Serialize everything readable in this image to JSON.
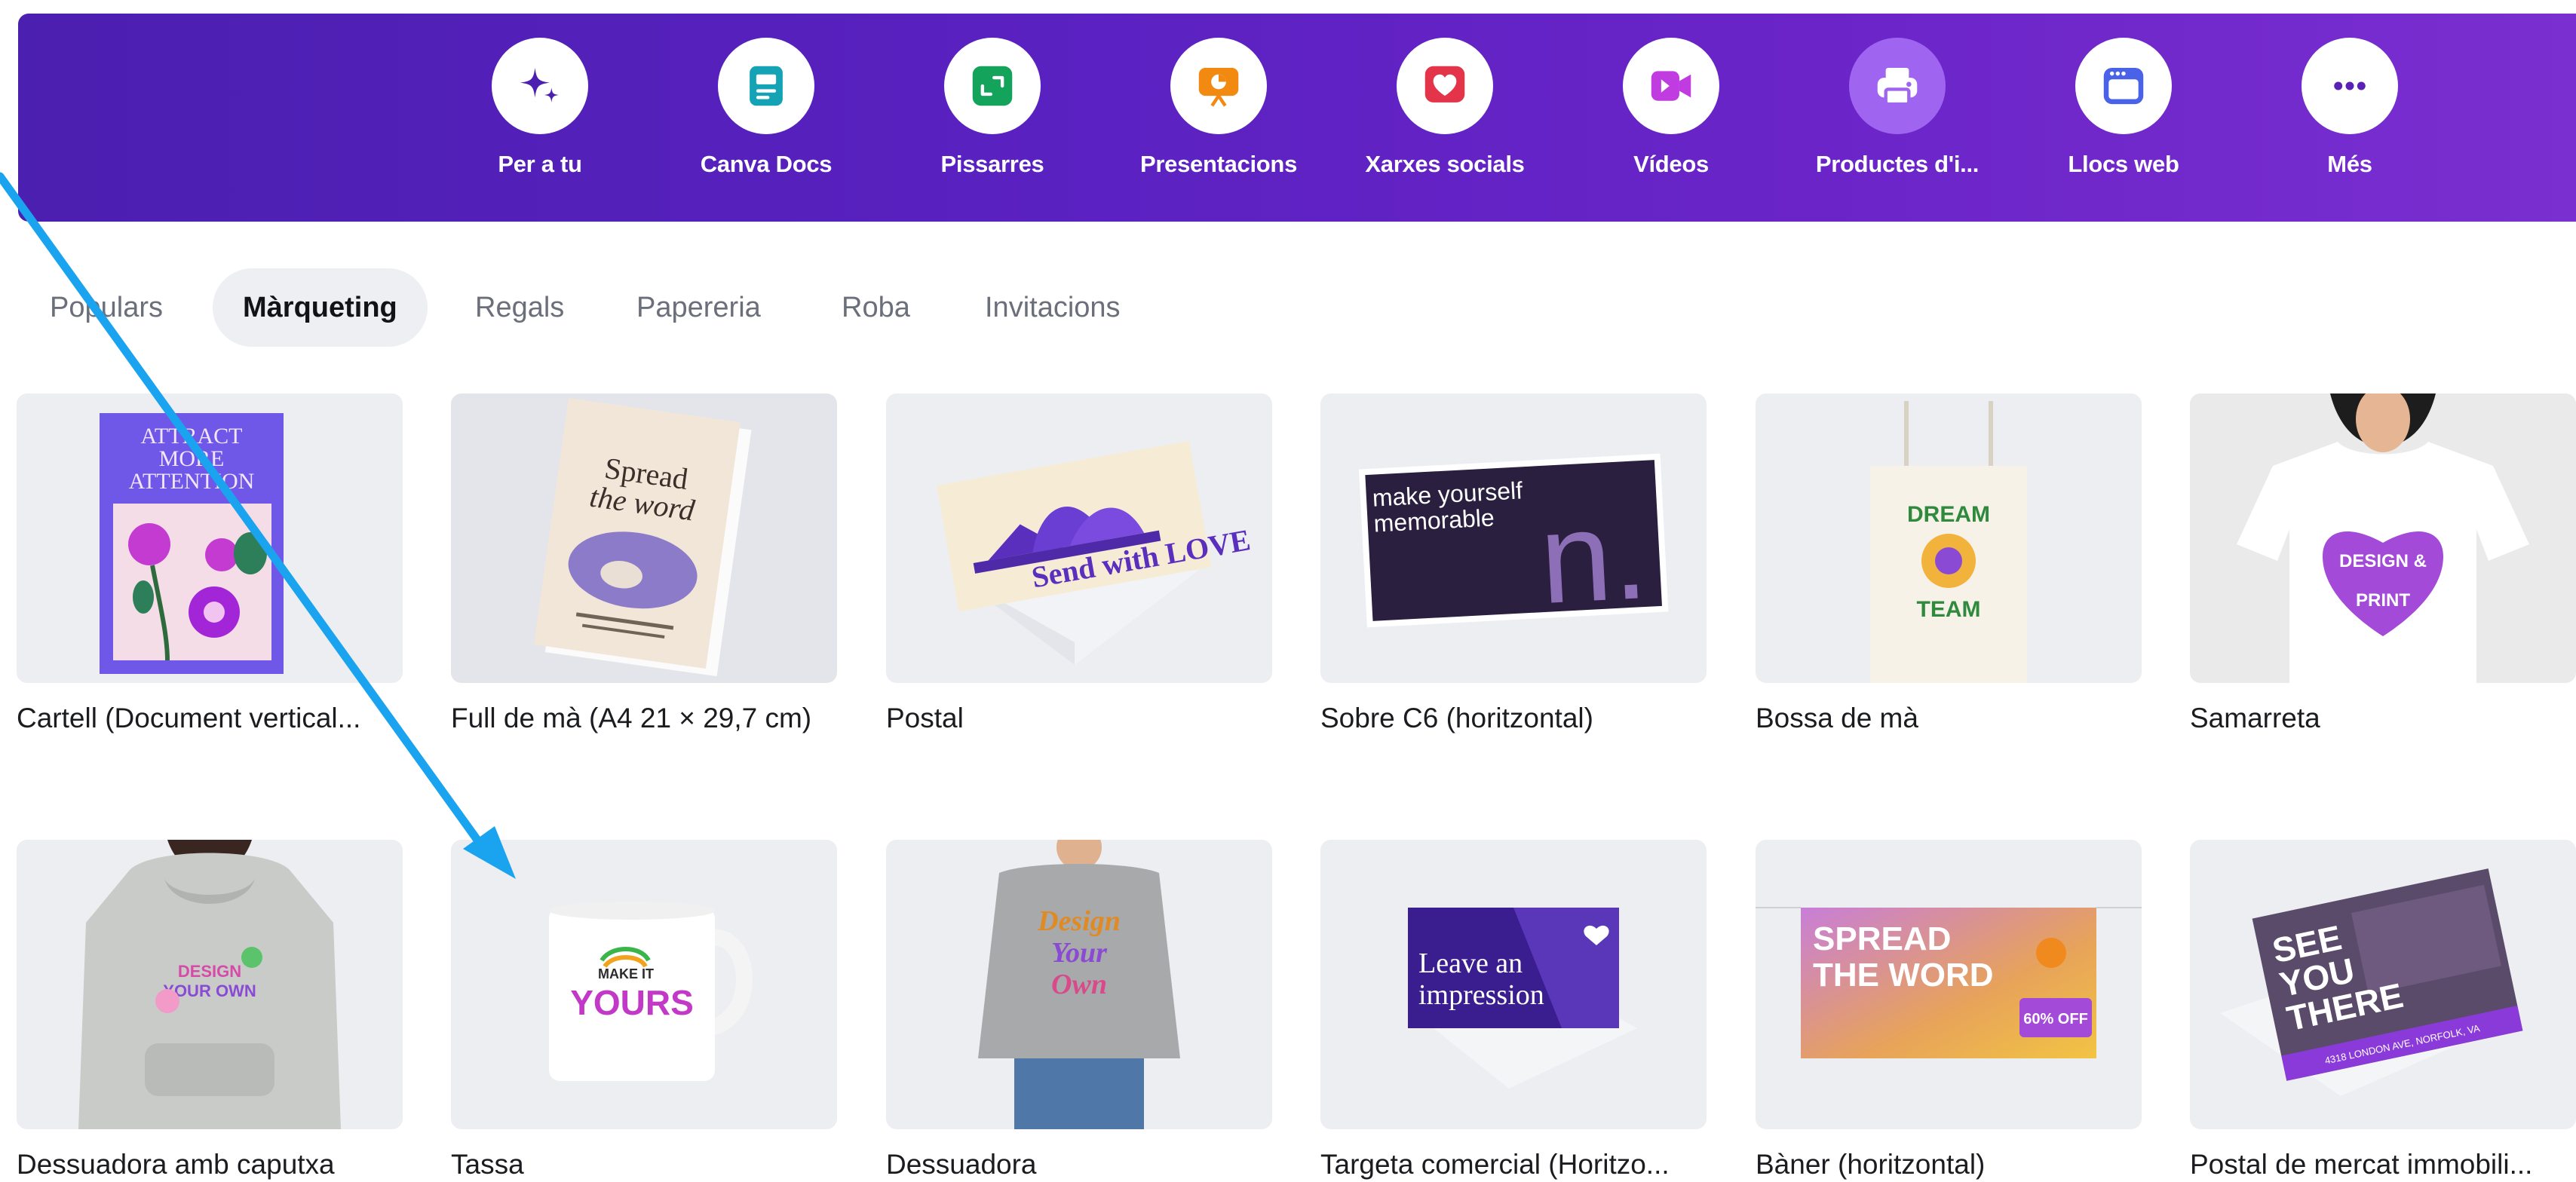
{
  "nav": {
    "items": [
      {
        "label": "Per a tu",
        "icon": "sparkle-icon"
      },
      {
        "label": "Canva Docs",
        "icon": "document-icon"
      },
      {
        "label": "Pissarres",
        "icon": "whiteboard-icon"
      },
      {
        "label": "Presentacions",
        "icon": "presentation-icon"
      },
      {
        "label": "Xarxes socials",
        "icon": "heart-icon"
      },
      {
        "label": "Vídeos",
        "icon": "video-icon"
      },
      {
        "label": "Productes d'i...",
        "icon": "printer-icon"
      },
      {
        "label": "Llocs web",
        "icon": "browser-icon"
      },
      {
        "label": "Més",
        "icon": "more-icon"
      }
    ],
    "active_index": 6
  },
  "subtabs": {
    "items": [
      "Populars",
      "Màrqueting",
      "Regals",
      "Papereria",
      "Roba",
      "Invitacions"
    ],
    "active": "Màrqueting"
  },
  "cards": [
    {
      "label": "Cartell (Document vertical...",
      "art": {
        "lines": [
          "ATTRACT",
          "MORE",
          "ATTENTION"
        ]
      }
    },
    {
      "label": "Full de mà (A4 21 × 29,7 cm)",
      "art": {
        "lines": [
          "Spread",
          "the word"
        ]
      }
    },
    {
      "label": "Postal",
      "art": {
        "lines": [
          "Send with LOVE"
        ]
      }
    },
    {
      "label": "Sobre C6 (horitzontal)",
      "art": {
        "lines": [
          "make yourself",
          "memorable",
          "n."
        ]
      }
    },
    {
      "label": "Bossa de mà",
      "art": {
        "lines": [
          "DREAM",
          "TEAM"
        ]
      }
    },
    {
      "label": "Samarreta",
      "art": {
        "lines": [
          "DESIGN &",
          "PRINT"
        ]
      }
    },
    {
      "label": "Dessuadora amb caputxa",
      "art": {
        "lines": [
          "DESIGN",
          "YOUR OWN"
        ]
      }
    },
    {
      "label": "Tassa",
      "art": {
        "lines": [
          "MAKE IT",
          "YOURS"
        ]
      }
    },
    {
      "label": "Dessuadora",
      "art": {
        "lines": [
          "Design",
          "Your",
          "Own"
        ]
      }
    },
    {
      "label": "Targeta comercial (Horitzo...",
      "art": {
        "lines": [
          "Leave an",
          "impression"
        ]
      }
    },
    {
      "label": "Bàner (horitzontal)",
      "art": {
        "lines": [
          "SPREAD",
          "THE WORD",
          "60% OFF"
        ]
      }
    },
    {
      "label": "Postal de mercat immobili...",
      "art": {
        "lines": [
          "SEE",
          "YOU",
          "THERE",
          "4318 LONDON AVE, NORFOLK, VA"
        ]
      }
    }
  ],
  "colors": {
    "band_start": "#4b1fb0",
    "band_end": "#7a2fd0",
    "active_circle": "#a065f0",
    "annotation_arrow": "#1aa3ef"
  }
}
